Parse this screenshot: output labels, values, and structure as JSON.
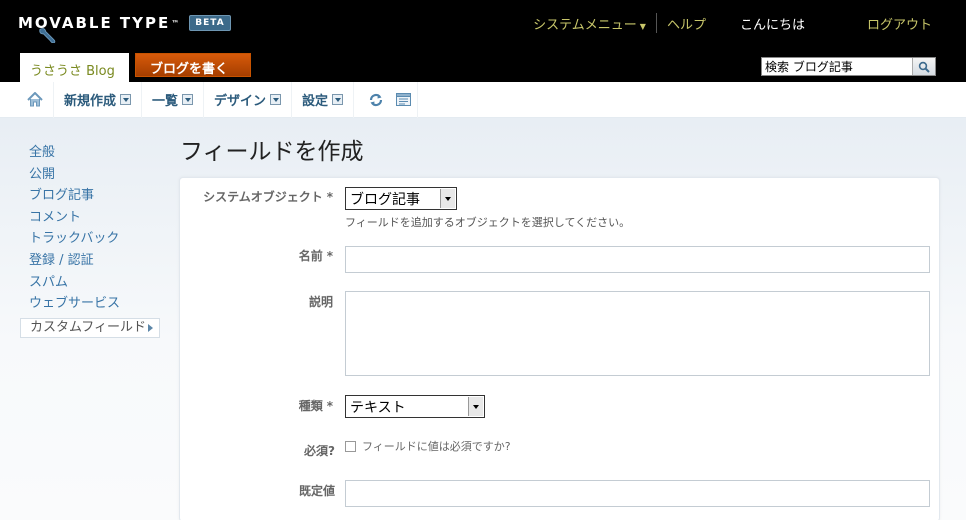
{
  "header": {
    "logo_text": "MOVABLE TYPE",
    "logo_tm": "™",
    "beta_badge": "BETA",
    "system_menu": "システムメニュー",
    "help": "ヘルプ",
    "greeting": "こんにちは",
    "logout": "ログアウト",
    "blog_name": "うさうさ Blog",
    "write_button": "ブログを書く",
    "search_value": "検索 ブログ記事"
  },
  "menubar": {
    "items": [
      {
        "label": "新規作成"
      },
      {
        "label": "一覧"
      },
      {
        "label": "デザイン"
      },
      {
        "label": "設定"
      }
    ]
  },
  "sidebar": {
    "items": [
      {
        "label": "全般"
      },
      {
        "label": "公開"
      },
      {
        "label": "ブログ記事"
      },
      {
        "label": "コメント"
      },
      {
        "label": "トラックバック"
      },
      {
        "label": "登録 / 認証"
      },
      {
        "label": "スパム"
      },
      {
        "label": "ウェブサービス"
      }
    ],
    "active_label": "カスタムフィールド"
  },
  "page": {
    "title": "フィールドを作成"
  },
  "form": {
    "object_label": "システムオブジェクト",
    "required_mark": "*",
    "object_value": "ブログ記事",
    "object_hint": "フィールドを追加するオブジェクトを選択してください。",
    "name_label": "名前",
    "description_label": "説明",
    "type_label": "種類",
    "type_value": "テキスト",
    "required_label": "必須?",
    "required_checkbox_text": "フィールドに値は必須ですか?",
    "default_label": "既定値"
  }
}
